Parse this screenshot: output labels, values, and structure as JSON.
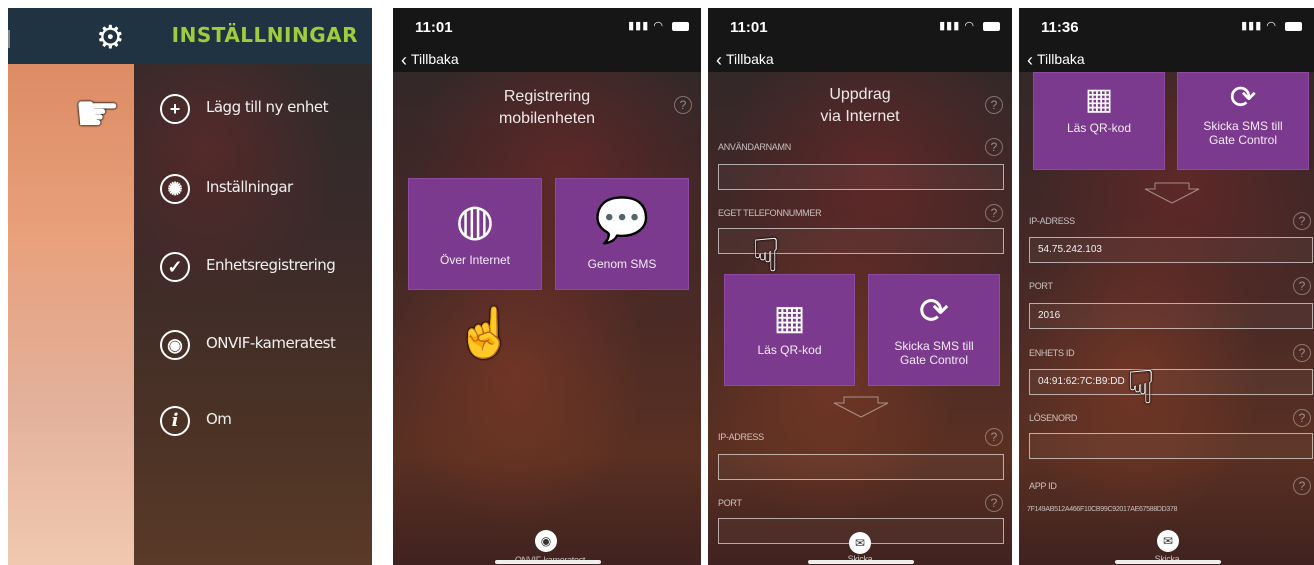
{
  "panel1": {
    "header_title": "INSTÄLLNINGAR",
    "menu": [
      {
        "icon": "plus-circle-icon",
        "glyph": "+",
        "label": "Lägg till ny enhet"
      },
      {
        "icon": "gear-circle-icon",
        "glyph": "✺",
        "label": "Inställningar"
      },
      {
        "icon": "check-circle-icon",
        "glyph": "✓",
        "label": "Enhetsregistrering"
      },
      {
        "icon": "camera-circle-icon",
        "glyph": "◉",
        "label": "ONVIF-kameratest"
      },
      {
        "icon": "info-circle-icon",
        "glyph": "i",
        "label": "Om"
      }
    ]
  },
  "panel2": {
    "time": "11:01",
    "back_label": "Tillbaka",
    "title_line1": "Registrering",
    "title_line2": "mobilenheten",
    "tile_internet": "Över Internet",
    "tile_sms": "Genom SMS",
    "bottom_label": "ONVIF-kameratest"
  },
  "panel3": {
    "time": "11:01",
    "back_label": "Tillbaka",
    "title_line1": "Uppdrag",
    "title_line2": "via Internet",
    "label_username": "ANVÄNDARNAMN",
    "label_phone": "EGET TELEFONNUMMER",
    "tile_qr": "Läs QR-kod",
    "tile_sms": "Skicka SMS till Gate Control",
    "label_ip": "IP-ADRESS",
    "label_port": "PORT",
    "bottom_label": "Skicka"
  },
  "panel4": {
    "time": "11:36",
    "back_label": "Tillbaka",
    "tile_qr": "Läs QR-kod",
    "tile_sms": "Skicka SMS till Gate Control",
    "label_ip": "IP-ADRESS",
    "value_ip": "54.75.242.103",
    "label_port": "PORT",
    "value_port": "2016",
    "label_device_id": "ENHETS ID",
    "value_device_id": "04:91:62:7C:B9:DD",
    "label_password": "LÖSENORD",
    "value_password": "",
    "label_app_id": "APP ID",
    "value_app_id": "7F149AB512A466F10CB99C92017AE67588DD378",
    "bottom_label": "Skicka"
  }
}
